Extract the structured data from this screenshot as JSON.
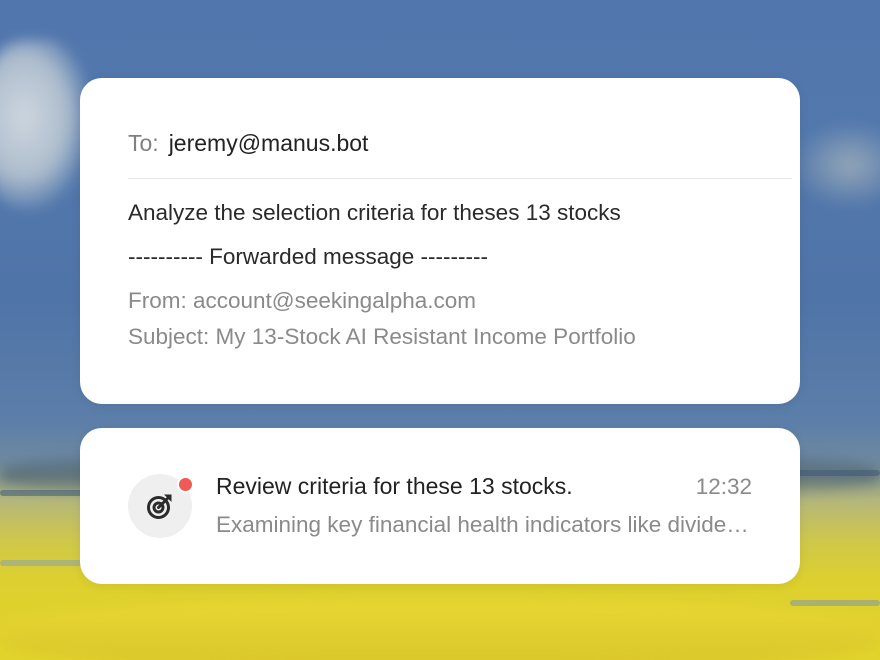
{
  "compose": {
    "to_label": "To:",
    "to_value": "jeremy@manus.bot",
    "body_line": "Analyze the selection criteria for theses 13 stocks",
    "forward_header": "---------- Forwarded message ---------",
    "from_line": "From: account@seekingalpha.com",
    "subject_line": "Subject: My 13-Stock AI Resistant Income Portfolio"
  },
  "task": {
    "icon": "target-arrow-icon",
    "unread_indicator_color": "#ee5a55",
    "title": "Review criteria for these 13 stocks.",
    "time": "12:32",
    "preview": "Examining key financial health indicators like dividend yield, payout ratio, and debt levels"
  }
}
